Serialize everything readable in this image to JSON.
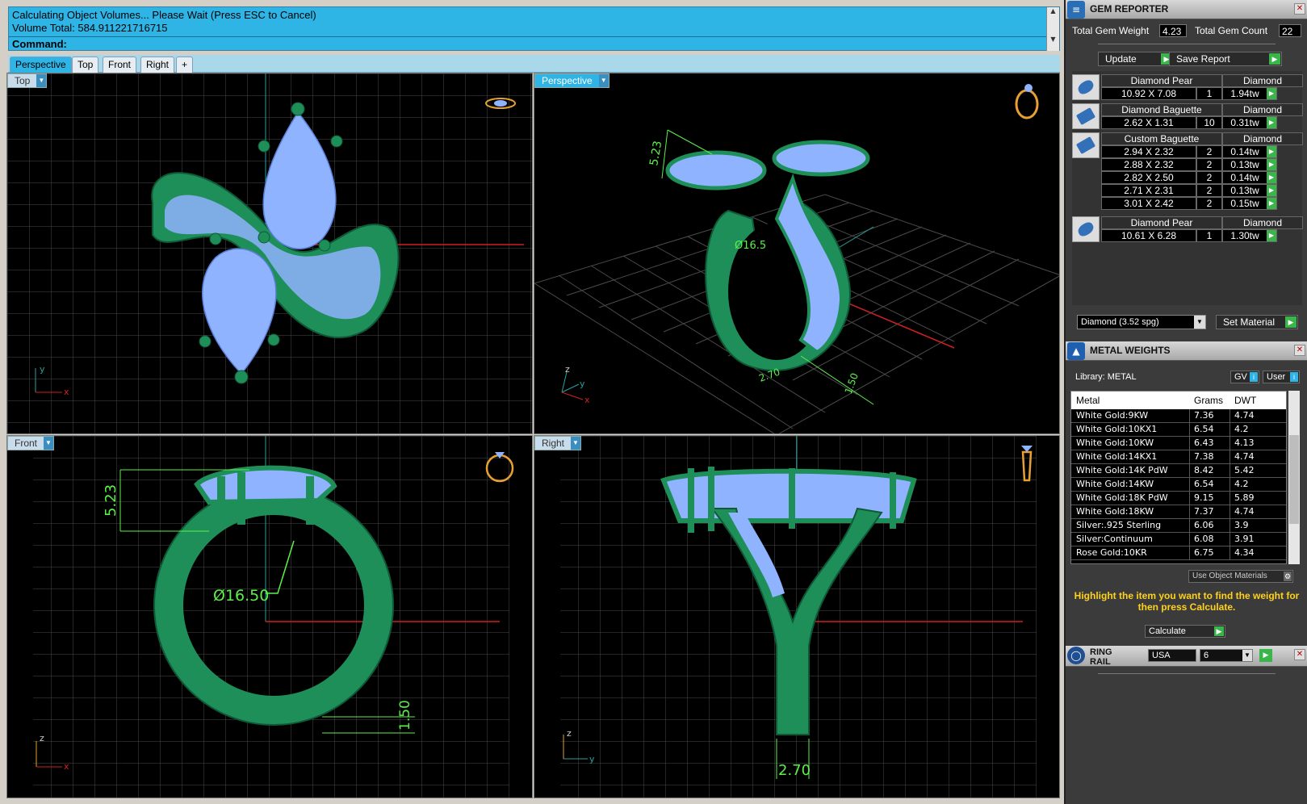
{
  "command": {
    "history_line1": "Calculating Object Volumes... Please Wait (Press ESC to Cancel)",
    "history_line2": "Volume Total: 584.911221716715",
    "prompt": "Command:"
  },
  "tabs": [
    "Perspective",
    "Top",
    "Front",
    "Right",
    "+"
  ],
  "viewports": {
    "top": {
      "label": "Top",
      "axis_y": "y",
      "axis_x": "x"
    },
    "perspective": {
      "label": "Perspective",
      "dim1": "5.23",
      "dim2": "Ø16.5",
      "dim3": "2.70",
      "dim4": "1.50",
      "axis_z": "z",
      "axis_y": "y",
      "axis_x": "x"
    },
    "front": {
      "label": "Front",
      "dim_height": "5.23",
      "dim_diameter": "Ø16.50",
      "dim_bottom": "1.50",
      "axis_z": "z",
      "axis_x": "x"
    },
    "right": {
      "label": "Right",
      "dim_width": "2.70",
      "axis_z": "z",
      "axis_y": "y"
    }
  },
  "gem_reporter": {
    "title": "GEM REPORTER",
    "total_weight_label": "Total Gem Weight",
    "total_weight": "4.23",
    "total_count_label": "Total Gem Count",
    "total_count": "22",
    "update_label": "Update",
    "save_report_label": "Save Report",
    "groups": [
      {
        "name": "Diamond Pear",
        "material": "Diamond",
        "rows": [
          [
            "10.92 X 7.08",
            "1",
            "1.94tw"
          ]
        ]
      },
      {
        "name": "Diamond Baguette",
        "material": "Diamond",
        "rows": [
          [
            "2.62 X 1.31",
            "10",
            "0.31tw"
          ]
        ]
      },
      {
        "name": "Custom Baguette",
        "material": "Diamond",
        "rows": [
          [
            "2.94 X 2.32",
            "2",
            "0.14tw"
          ],
          [
            "2.88 X 2.32",
            "2",
            "0.13tw"
          ],
          [
            "2.82 X 2.50",
            "2",
            "0.14tw"
          ],
          [
            "2.71 X 2.31",
            "2",
            "0.13tw"
          ],
          [
            "3.01 X 2.42",
            "2",
            "0.15tw"
          ]
        ]
      },
      {
        "name": "Diamond Pear",
        "material": "Diamond",
        "rows": [
          [
            "10.61 X 6.28",
            "1",
            "1.30tw"
          ]
        ]
      }
    ],
    "material_select": "Diamond    (3.52 spg)",
    "set_material_label": "Set Material"
  },
  "metal_weights": {
    "title": "METAL WEIGHTS",
    "library_label": "Library: METAL",
    "gv_label": "GV",
    "user_label": "User",
    "columns": [
      "Metal",
      "Grams",
      "DWT"
    ],
    "rows": [
      [
        "White Gold:9KW",
        "7.36",
        "4.74"
      ],
      [
        "White Gold:10KX1",
        "6.54",
        "4.2"
      ],
      [
        "White Gold:10KW",
        "6.43",
        "4.13"
      ],
      [
        "White Gold:14KX1",
        "7.38",
        "4.74"
      ],
      [
        "White Gold:14K PdW",
        "8.42",
        "5.42"
      ],
      [
        "White Gold:14KW",
        "6.54",
        "4.2"
      ],
      [
        "White Gold:18K PdW",
        "9.15",
        "5.89"
      ],
      [
        "White Gold:18KW",
        "7.37",
        "4.74"
      ],
      [
        "Silver:.925 Sterling",
        "6.06",
        "3.9"
      ],
      [
        "Silver:Continuum",
        "6.08",
        "3.91"
      ],
      [
        "Rose Gold:10KR",
        "6.75",
        "4.34"
      ]
    ],
    "use_object_materials": "Use Object Materials",
    "hint": "Highlight the item you want to find the weight for then press Calculate.",
    "calculate_label": "Calculate"
  },
  "ring_rail": {
    "title": "RING RAIL",
    "standard": "USA",
    "size": "6"
  },
  "colors": {
    "command_bg": "#2fb4e6",
    "ring_green": "#1f8f5a",
    "gem_blue": "#8fb3ff",
    "dim_green": "#5df04a",
    "axis_red": "#d02020"
  }
}
